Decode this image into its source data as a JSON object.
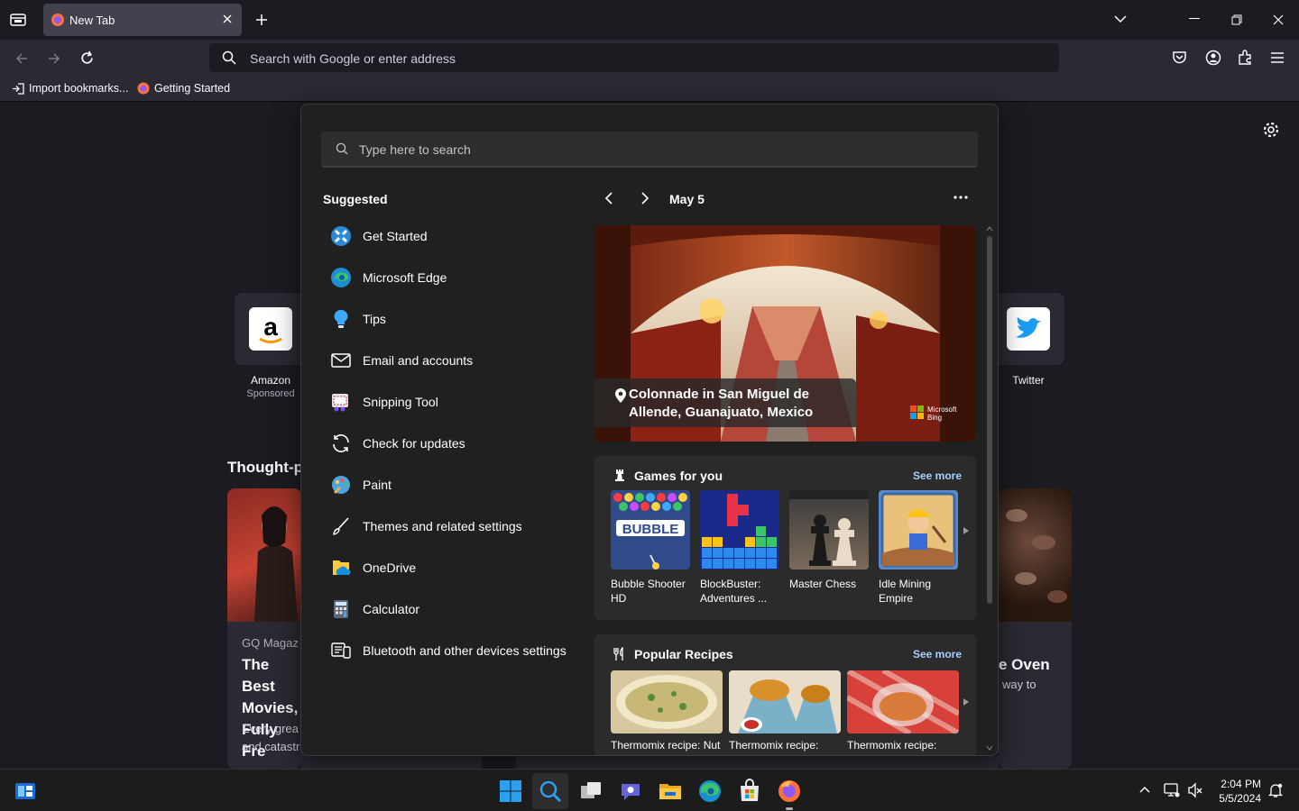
{
  "browser": {
    "tab_title": "New Tab",
    "address_placeholder": "Search with Google or enter address",
    "bookmarks": [
      "Import bookmarks...",
      "Getting Started"
    ]
  },
  "newtab": {
    "shortcuts": [
      {
        "label": "Amazon",
        "sub": "Sponsored"
      },
      {
        "label": "Twitter",
        "sub": ""
      }
    ],
    "section_title": "Thought-p",
    "left_card": {
      "source": "GQ Magaz",
      "headline": "The Best Movies, Fully Fre",
      "body": "Every grea DiCaprio's animalistic grunting and catastrophic..."
    },
    "right_card": {
      "headline": "e Oven",
      "body": "way to"
    }
  },
  "flyout": {
    "search_placeholder": "Type here to search",
    "suggested_title": "Suggested",
    "suggested": [
      {
        "label": "Get Started",
        "icon": "get-started-icon"
      },
      {
        "label": "Microsoft Edge",
        "icon": "edge-icon"
      },
      {
        "label": "Tips",
        "icon": "tips-icon"
      },
      {
        "label": "Email and accounts",
        "icon": "mail-icon"
      },
      {
        "label": "Snipping Tool",
        "icon": "snipping-tool-icon"
      },
      {
        "label": "Check for updates",
        "icon": "sync-icon"
      },
      {
        "label": "Paint",
        "icon": "paint-icon"
      },
      {
        "label": "Themes and related settings",
        "icon": "brush-icon"
      },
      {
        "label": "OneDrive",
        "icon": "onedrive-icon"
      },
      {
        "label": "Calculator",
        "icon": "calculator-icon"
      },
      {
        "label": "Bluetooth and other devices settings",
        "icon": "devices-icon"
      }
    ],
    "date": "May 5",
    "hero_caption": "Colonnade in San Miguel de Allende, Guanajuato, Mexico",
    "hero_brand": "Microsoft Bing",
    "games": {
      "title": "Games for you",
      "see_more": "See more",
      "items": [
        "Bubble Shooter HD",
        "BlockBuster: Adventures ...",
        "Master Chess",
        "Idle Mining Empire"
      ]
    },
    "recipes": {
      "title": "Popular Recipes",
      "see_more": "See more",
      "items": [
        "Thermomix recipe: Nut",
        "Thermomix recipe:",
        "Thermomix recipe:"
      ]
    }
  },
  "taskbar": {
    "time": "2:04 PM",
    "date": "5/5/2024"
  },
  "colors": {
    "accent": "#a8d0ff",
    "flyout_bg": "#202020",
    "page_bg": "#1c1b22"
  }
}
